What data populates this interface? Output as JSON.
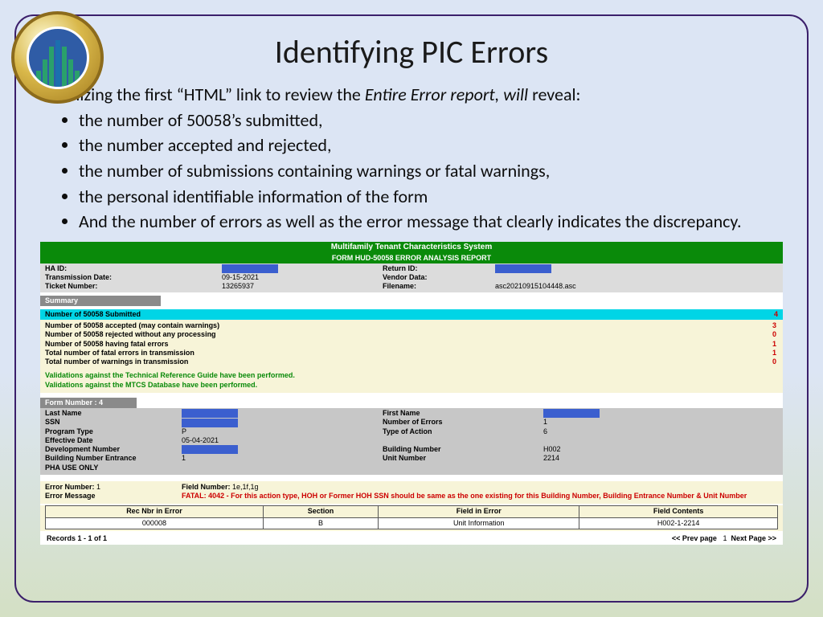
{
  "title": "Identifying PIC Errors",
  "intro": {
    "lead_a": "Utilizing the first “HTML” link to review the ",
    "lead_em": "Entire Error report, will",
    "lead_b": " reveal:",
    "bullets": [
      "the number of 50058’s submitted,",
      "the number accepted and rejected,",
      "the number of submissions containing warnings or fatal warnings,",
      "the personal identifiable information of the form",
      "And the number of errors as well as the error message that clearly indicates the discrepancy."
    ]
  },
  "report": {
    "header": "Multifamily Tenant Characteristics System",
    "subheader": "FORM HUD-50058 ERROR ANALYSIS REPORT",
    "meta": {
      "haid_label": "HA ID:",
      "return_label": "Return ID:",
      "trans_label": "Transmission Date:",
      "trans_val": "09-15-2021",
      "vendor_label": "Vendor Data:",
      "ticket_label": "Ticket Number:",
      "ticket_val": "13265937",
      "file_label": "Filename:",
      "file_val": "asc20210915104448.asc"
    },
    "summary_tab": "Summary",
    "submitted_label": "Number of 50058 Submitted",
    "submitted_val": "4",
    "rows": [
      {
        "label": "Number of 50058 accepted (may contain warnings)",
        "val": "3"
      },
      {
        "label": "Number of 50058 rejected without any processing",
        "val": "0"
      },
      {
        "label": "Number of 50058 having fatal errors",
        "val": "1"
      },
      {
        "label": "Total number of fatal errors in transmission",
        "val": "1"
      },
      {
        "label": "Total number of warnings in transmission",
        "val": "0"
      }
    ],
    "validation1": "Validations against the Technical Reference Guide have been performed.",
    "validation2": "Validations against the MTCS Database have been performed.",
    "form_tab": "Form Number : 4",
    "form": {
      "last_name": "Last Name",
      "first_name": "First Name",
      "ssn": "SSN",
      "num_err_label": "Number of Errors",
      "num_err_val": "1",
      "prog_label": "Program Type",
      "prog_val": "P",
      "action_label": "Type of Action",
      "action_val": "6",
      "eff_label": "Effective Date",
      "eff_val": "05-04-2021",
      "dev_label": "Development Number",
      "bldg_label": "Building Number",
      "bldg_val": "H002",
      "ent_label": "Building Number Entrance",
      "ent_val": "1",
      "unit_label": "Unit Number",
      "unit_val": "2214",
      "pha_label": "PHA USE ONLY"
    },
    "error": {
      "num_label": "Error Number:",
      "num_val": "1",
      "field_label": "Field Number:",
      "field_val": "1e,1f,1g",
      "msg_label": "Error Message",
      "msg_val": "FATAL: 4042 - For this action type, HOH or Former HOH SSN should be same as the one existing for this Building Number, Building Entrance Number & Unit Number"
    },
    "table": {
      "h1": "Rec Nbr in Error",
      "h2": "Section",
      "h3": "Field in Error",
      "h4": "Field Contents",
      "c1": "000008",
      "c2": "B",
      "c3": "Unit Information",
      "c4": "H002-1-2214"
    },
    "pager": {
      "records": "Records 1 - 1 of 1",
      "prev": "<< Prev page",
      "page": "1",
      "next": "Next Page >>"
    }
  }
}
